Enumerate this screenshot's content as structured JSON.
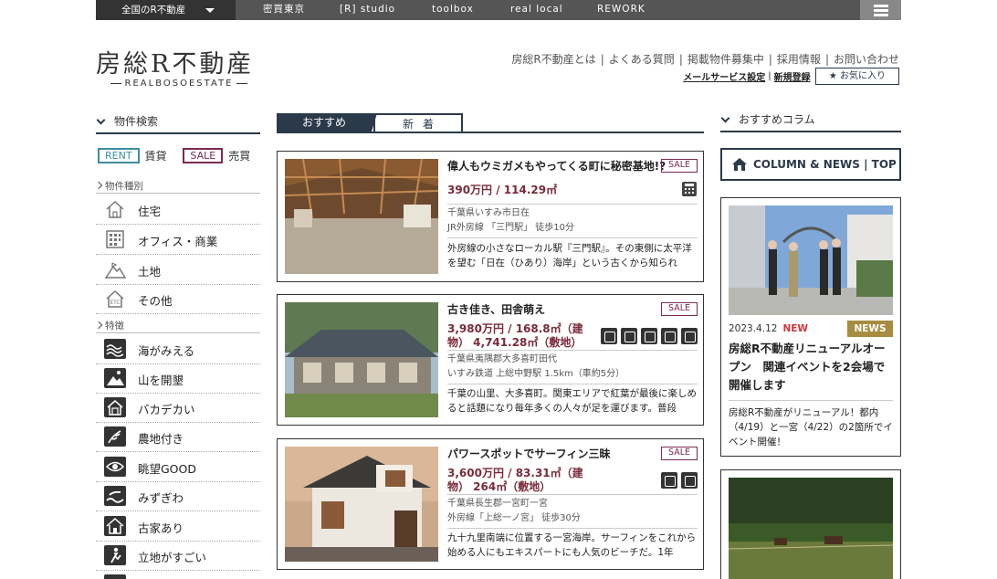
{
  "topbar": {
    "region": "全国のR不動産",
    "nav": [
      "密買東京",
      "[R] studio",
      "toolbox",
      "real local",
      "REWORK"
    ]
  },
  "header": {
    "logo": "房総R不動産",
    "logo_sub": "REALBOSOESTATE",
    "links": [
      "房総R不動産とは",
      "よくある質問",
      "掲載物件募集中",
      "採用情報",
      "お問い合わせ"
    ],
    "mail_service": "メールサービス設定",
    "register": "新規登録",
    "favorites": "★ お気に入り"
  },
  "sidebar": {
    "title": "物件検索",
    "rent_tag": "RENT",
    "rent_label": "賃貸",
    "sale_tag": "SALE",
    "sale_label": "売買",
    "type_head": "物件種別",
    "types": [
      {
        "label": "住宅",
        "icon": "house-icon"
      },
      {
        "label": "オフィス・商業",
        "icon": "office-icon"
      },
      {
        "label": "土地",
        "icon": "land-icon"
      },
      {
        "label": "その他",
        "icon": "etc-icon"
      }
    ],
    "feature_head": "特徴",
    "features": [
      {
        "label": "海がみえる",
        "icon": "sea-icon"
      },
      {
        "label": "山を開墾",
        "icon": "mountain-icon"
      },
      {
        "label": "バカデカい",
        "icon": "big-house-icon"
      },
      {
        "label": "農地付き",
        "icon": "farm-icon"
      },
      {
        "label": "眺望GOOD",
        "icon": "eye-icon"
      },
      {
        "label": "みずぎわ",
        "icon": "water-icon"
      },
      {
        "label": "古家あり",
        "icon": "old-house-icon"
      },
      {
        "label": "立地がすごい",
        "icon": "location-icon"
      }
    ]
  },
  "tabs": {
    "recommended": "おすすめ",
    "new": "新着"
  },
  "listings": [
    {
      "title": "偉人もウミガメもやってくる町に秘密基地!?",
      "tag": "SALE",
      "price": "390万円 / 114.29㎡",
      "address1": "千葉県いすみ市日在",
      "address2": "JR外房線 「三門駅」 徒歩10分",
      "desc": "外房線の小さなローカル駅『三門駅』。その東側に太平洋を望む「日在（ひあり）海岸」という古くから知られ"
    },
    {
      "title": "古き佳き、田舎萌え",
      "tag": "SALE",
      "price": "3,980万円 / 168.8㎡（建物） 4,741.28㎡（敷地）",
      "address1": "千葉県夷隅郡大多喜町田代",
      "address2": "いすみ鉄道 上総中野駅 1.5km（車約5分）",
      "desc": "千葉の山里、大多喜町。関東エリアで紅葉が最後に楽しめると話題になり毎年多くの人々が足を運びます。普段"
    },
    {
      "title": "パワースポットでサーフィン三昧",
      "tag": "SALE",
      "price": "3,600万円 / 83.31㎡（建物） 264㎡（敷地）",
      "address1": "千葉県長生郡一宮町一宮",
      "address2": "外房線「上総一ノ宮」 徒歩30分",
      "desc": "九十九里南端に位置する一宮海岸。サーフィンをこれから始める人にもエキスパートにも人気のビーチだ。1年"
    }
  ],
  "column": {
    "title": "おすすめコラム",
    "button": "COLUMN & NEWS | TOP",
    "news": {
      "date": "2023.4.12",
      "new": "NEW",
      "badge": "NEWS",
      "title": "房総R不動産リニューアルオープン　関連イベントを2会場で開催します",
      "desc": "房総R不動産がリニューアル！都内（4/19）と一宮（4/22）の2箇所でイベント開催！"
    }
  }
}
